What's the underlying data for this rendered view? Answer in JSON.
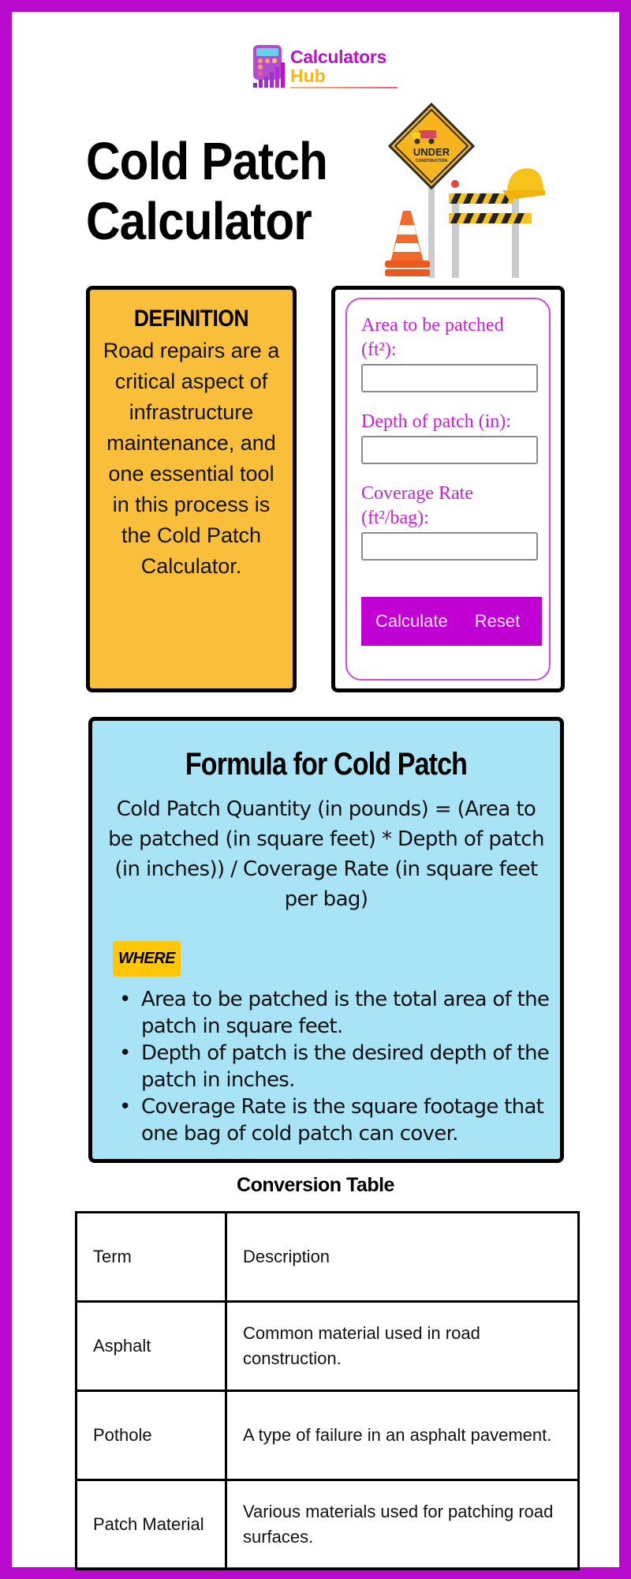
{
  "brand": {
    "line1": "Calculators",
    "line2": "Hub",
    "icon": "calculator-chart-icon",
    "colors": {
      "primary": "#B614C9",
      "secondary": "#F5B71B"
    }
  },
  "page": {
    "title_line1": "Cold Patch",
    "title_line2": "Calculator",
    "hero_image": "under-construction-illustration",
    "hero_sign_text1": "UNDER",
    "hero_sign_text2": "CONSTRUCTION",
    "frame_color": "#B90BCE"
  },
  "definition": {
    "heading": "DEFINITION",
    "text": "Road repairs are a critical aspect of infrastructure maintenance, and one essential tool in this process is the Cold Patch Calculator.",
    "bg_color": "#F9BE3A"
  },
  "calculator": {
    "fields": [
      {
        "label": "Area to be patched (ft²):",
        "value": "",
        "placeholder": ""
      },
      {
        "label": "Depth of patch (in):",
        "value": "",
        "placeholder": ""
      },
      {
        "label": "Coverage Rate (ft²/bag):",
        "value": "",
        "placeholder": ""
      }
    ],
    "calculate_label": "Calculate",
    "reset_label": "Reset",
    "accent_color": "#C000D3"
  },
  "formula": {
    "heading": "Formula for Cold Patch",
    "text": "Cold Patch Quantity (in pounds) = (Area to be patched (in square feet) * Depth of patch (in inches)) / Coverage Rate (in square feet per bag)",
    "where_label": "WHERE",
    "items": [
      "Area to be patched is the total area of the patch in square feet.",
      "Depth of patch is the desired depth of the patch in inches.",
      "Coverage Rate is the square footage that one bag of cold patch can cover."
    ],
    "bg_color": "#A8E4F6"
  },
  "table": {
    "title": "Conversion Table",
    "headers": [
      "Term",
      "Description"
    ],
    "rows": [
      [
        "Asphalt",
        "Common material used in road construction."
      ],
      [
        "Pothole",
        "A type of failure in an asphalt pavement."
      ],
      [
        "Patch Material",
        "Various materials used for patching road surfaces."
      ]
    ]
  }
}
